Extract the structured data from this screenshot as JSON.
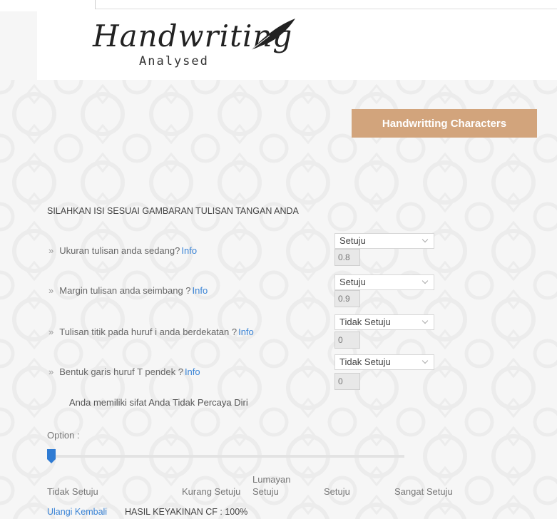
{
  "header": {
    "logo_script": "Handwriting",
    "logo_sub": "Analysed"
  },
  "characters_button": "Handwritting Characters",
  "instruction": "SILAHKAN ISI SESUAI GAMBARAN TULISAN TANGAN ANDA",
  "questions": [
    {
      "text": "Ukuran tulisan anda sedang?",
      "info": "Info",
      "answer": "Setuju",
      "cf": "0.8"
    },
    {
      "text": "Margin tulisan anda seimbang ?",
      "info": "Info",
      "answer": "Setuju",
      "cf": "0.9"
    },
    {
      "text": "Tulisan titik pada huruf i anda berdekatan ?",
      "info": "Info",
      "answer": "Tidak Setuju",
      "cf": "0"
    },
    {
      "text": "Bentuk garis huruf T pendek ?",
      "info": "Info",
      "answer": "Tidak Setuju",
      "cf": "0"
    }
  ],
  "bullet": "»",
  "result_text": "Anda memiliki sifat Anda Tidak Percaya Diri",
  "option_label": "Option :",
  "slider": {
    "value": 0,
    "accent": "#2f7bd3"
  },
  "scale_labels": [
    "Tidak Setuju",
    "Kurang Setuju",
    "Lumayan Setuju",
    "Setuju",
    "Sangat Setuju"
  ],
  "retry_link": "Ulangi Kembali",
  "cf_result": "HASIL KEYAKINAN CF : 100%",
  "colors": {
    "button": "#d2a47c",
    "link": "#3a84d6"
  }
}
